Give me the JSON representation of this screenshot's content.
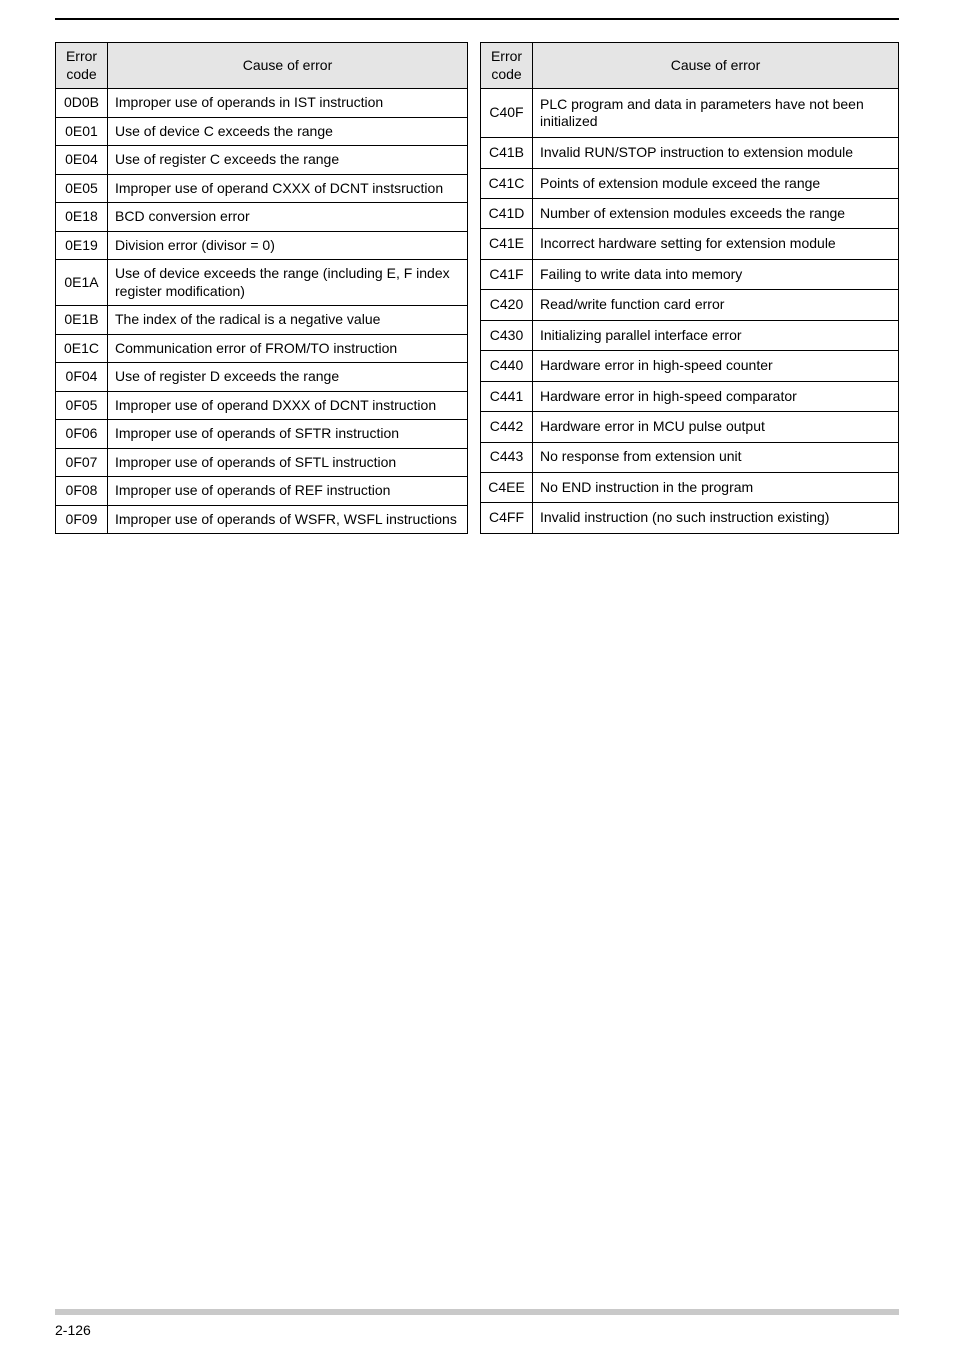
{
  "headers": {
    "error_code": "Error code",
    "cause": "Cause of error"
  },
  "left_rows": [
    {
      "code": "0D0B",
      "cause": "Improper use of operands in IST instruction"
    },
    {
      "code": "0E01",
      "cause": "Use of device C exceeds the range"
    },
    {
      "code": "0E04",
      "cause": "Use of register C exceeds the range"
    },
    {
      "code": "0E05",
      "cause": "Improper use of operand CXXX of DCNT instsruction"
    },
    {
      "code": "0E18",
      "cause": "BCD conversion error"
    },
    {
      "code": "0E19",
      "cause": "Division error (divisor = 0)"
    },
    {
      "code": "0E1A",
      "cause": "Use of device exceeds the range (including E, F index register modification)"
    },
    {
      "code": "0E1B",
      "cause": "The index of the radical is a negative value"
    },
    {
      "code": "0E1C",
      "cause": "Communication error of FROM/TO instruction"
    },
    {
      "code": "0F04",
      "cause": "Use of register D exceeds the range"
    },
    {
      "code": "0F05",
      "cause": "Improper use of operand DXXX of DCNT instruction"
    },
    {
      "code": "0F06",
      "cause": "Improper use of operands of SFTR instruction"
    },
    {
      "code": "0F07",
      "cause": "Improper use of operands of SFTL instruction"
    },
    {
      "code": "0F08",
      "cause": "Improper use of operands of REF instruction"
    },
    {
      "code": "0F09",
      "cause": "Improper use of operands of WSFR, WSFL instructions"
    }
  ],
  "right_rows": [
    {
      "code": "C40F",
      "cause": "PLC program and data in parameters have not been initialized"
    },
    {
      "code": "C41B",
      "cause": "Invalid RUN/STOP instruction to extension module"
    },
    {
      "code": "C41C",
      "cause": "Points of extension module exceed the range"
    },
    {
      "code": "C41D",
      "cause": "Number of extension modules exceeds the range"
    },
    {
      "code": "C41E",
      "cause": "Incorrect hardware setting for extension module"
    },
    {
      "code": "C41F",
      "cause": "Failing to write data into memory"
    },
    {
      "code": "C420",
      "cause": "Read/write function card error"
    },
    {
      "code": "C430",
      "cause": "Initializing parallel interface error"
    },
    {
      "code": "C440",
      "cause": "Hardware error in high-speed counter"
    },
    {
      "code": "C441",
      "cause": "Hardware error in high-speed comparator"
    },
    {
      "code": "C442",
      "cause": "Hardware error in MCU pulse output"
    },
    {
      "code": "C443",
      "cause": "No response from extension unit"
    },
    {
      "code": "C4EE",
      "cause": "No END instruction in the program"
    },
    {
      "code": "C4FF",
      "cause": "Invalid instruction (no such instruction existing)"
    }
  ],
  "page_number": "2-126"
}
